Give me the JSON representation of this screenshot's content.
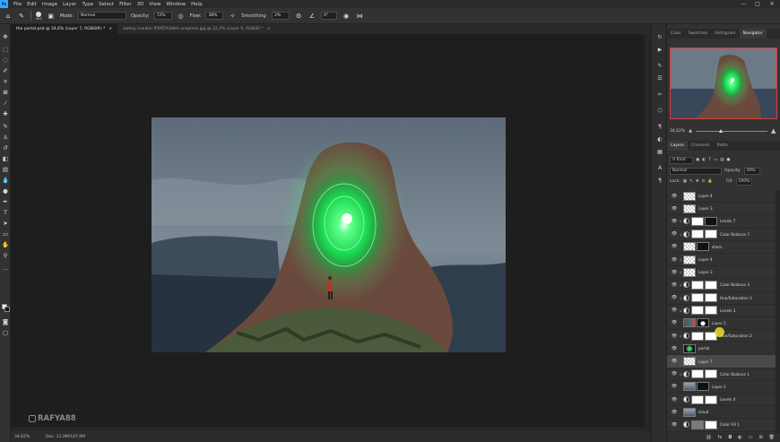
{
  "app": {
    "logo": "Ps"
  },
  "menu": [
    "File",
    "Edit",
    "Image",
    "Layer",
    "Type",
    "Select",
    "Filter",
    "3D",
    "View",
    "Window",
    "Help"
  ],
  "window_controls": [
    "—",
    "□",
    "✕"
  ],
  "options_bar": {
    "brush_size": "900",
    "mode_label": "Mode:",
    "mode_value": "Normal",
    "opacity_label": "Opacity:",
    "opacity_value": "72%",
    "flow_label": "Flow:",
    "flow_value": "38%",
    "smoothing_label": "Smoothing:",
    "smoothing_value": "2%",
    "angle_value": "0°"
  },
  "tabs": [
    {
      "label": "the portal.psd @ 34,6% (Layer 7, RGB/8#) *",
      "active": true
    },
    {
      "label": "ashley knedler PI5PJTA3dhA unsplash.jpg @ 22,2% (Layer 0, RGB/8) *",
      "active": false
    }
  ],
  "right_tabs_top": [
    {
      "label": "Color",
      "active": false
    },
    {
      "label": "Swatches",
      "active": false
    },
    {
      "label": "Histogram",
      "active": false
    },
    {
      "label": "Navigator",
      "active": true
    }
  ],
  "navigator": {
    "zoom": "34,62%",
    "zoom_fraction": 0.35
  },
  "right_tabs_layers": [
    {
      "label": "Layers",
      "active": true
    },
    {
      "label": "Channels",
      "active": false
    },
    {
      "label": "Paths",
      "active": false
    }
  ],
  "layers_panel": {
    "filter_kind": "Kind",
    "blend_mode": "Normal",
    "opacity_label": "Opacity:",
    "opacity_value": "30%",
    "lock_label": "Lock:",
    "fill_label": "Fill:",
    "fill_value": "100%"
  },
  "layers": [
    {
      "name": "Layer 4",
      "clip": false,
      "adj": false,
      "thumb": "checker",
      "mask": false,
      "selected": false
    },
    {
      "name": "Layer 3",
      "clip": false,
      "adj": false,
      "thumb": "checker",
      "mask": false,
      "selected": false
    },
    {
      "name": "Levels 7",
      "clip": true,
      "adj": true,
      "thumb": "adj",
      "mask": "dark",
      "selected": false
    },
    {
      "name": "Color Balance 7",
      "clip": true,
      "adj": true,
      "thumb": "adj",
      "mask": "white",
      "selected": false
    },
    {
      "name": "stairs",
      "clip": false,
      "adj": false,
      "thumb": "checker",
      "mask": "dark",
      "selected": false
    },
    {
      "name": "Layer 4",
      "clip": true,
      "adj": false,
      "thumb": "checker",
      "mask": false,
      "selected": false
    },
    {
      "name": "Layer 3",
      "clip": true,
      "adj": false,
      "thumb": "checker",
      "mask": false,
      "selected": false
    },
    {
      "name": "Color Balance 3",
      "clip": true,
      "adj": true,
      "thumb": "adj",
      "mask": "white",
      "selected": false
    },
    {
      "name": "Hue/Saturation 3",
      "clip": true,
      "adj": true,
      "thumb": "adj",
      "mask": "white",
      "selected": false
    },
    {
      "name": "Levels 3",
      "clip": true,
      "adj": true,
      "thumb": "adj",
      "mask": "white",
      "selected": false
    },
    {
      "name": "Layer 2",
      "clip": false,
      "adj": false,
      "thumb": "photo",
      "mask": "figure",
      "selected": false
    },
    {
      "name": "Hue/Saturation 2",
      "clip": true,
      "adj": true,
      "thumb": "adj",
      "mask": "white",
      "selected": false
    },
    {
      "name": "portal",
      "clip": false,
      "adj": false,
      "thumb": "portal",
      "mask": false,
      "selected": false
    },
    {
      "name": "Layer 7",
      "clip": false,
      "adj": false,
      "thumb": "checker",
      "mask": false,
      "selected": true
    },
    {
      "name": "Color Balance 1",
      "clip": true,
      "adj": true,
      "thumb": "adj",
      "mask": "white",
      "selected": false
    },
    {
      "name": "Layer 1",
      "clip": false,
      "adj": false,
      "thumb": "sky",
      "mask": "dark",
      "selected": false
    },
    {
      "name": "Levels 4",
      "clip": false,
      "adj": true,
      "thumb": "adj",
      "mask": "white",
      "selected": false
    },
    {
      "name": "cloud",
      "clip": false,
      "adj": false,
      "thumb": "sky",
      "mask": false,
      "selected": false
    },
    {
      "name": "Color Fill 1",
      "clip": false,
      "adj": true,
      "thumb": "fill",
      "mask": "white",
      "selected": false
    }
  ],
  "footer_icons": [
    "link-icon",
    "fx-icon",
    "mask-icon",
    "adjustment-icon",
    "group-icon",
    "new-layer-icon",
    "trash-icon"
  ],
  "footer_glyphs": [
    "⛓",
    "fx",
    "◘",
    "◐",
    "▭",
    "⊞",
    "🗑"
  ],
  "status": {
    "zoom": "34,62%",
    "doc": "Doc: 11,9M/187,9M"
  },
  "watermark": {
    "text": "RAFYA88"
  },
  "colors": {
    "accent_nav_frame": "#e03a3a",
    "portal_green": "#2dff6a",
    "selection": "#4a4a4a"
  }
}
